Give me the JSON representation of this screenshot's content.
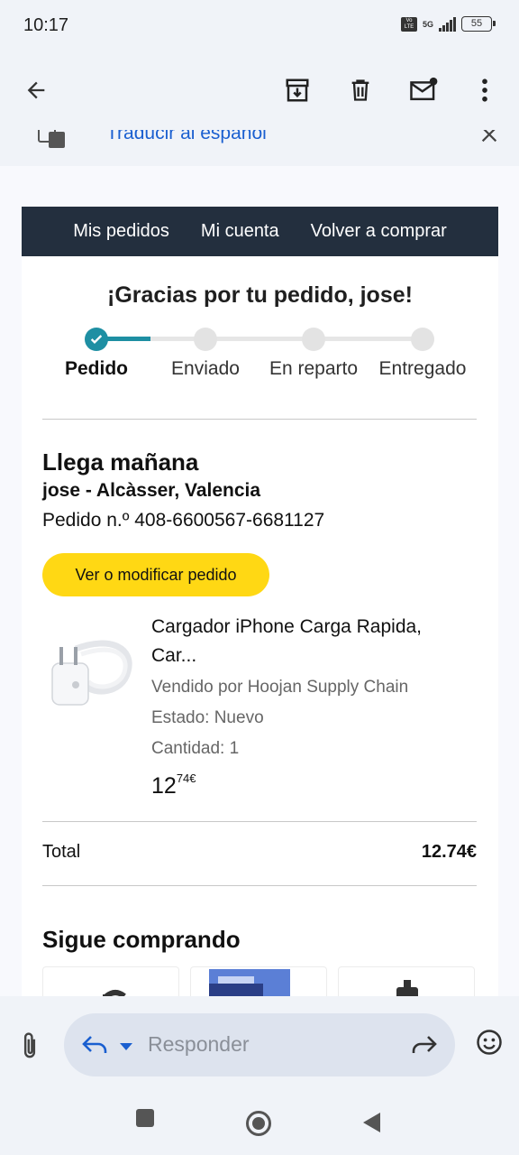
{
  "status": {
    "time": "10:17",
    "volte": "Vo LTE",
    "network": "5G",
    "battery": "55"
  },
  "toolbar": {
    "icons": [
      "back-arrow-icon",
      "archive-icon",
      "delete-icon",
      "mark-unread-icon",
      "more-vert-icon"
    ]
  },
  "translate": {
    "label": "Traducir al español"
  },
  "email": {
    "nav": [
      "Mis pedidos",
      "Mi cuenta",
      "Volver a comprar"
    ],
    "thanks": "¡Gracias por tu pedido, jose!",
    "steps": [
      "Pedido",
      "Enviado",
      "En reparto",
      "Entregado"
    ],
    "progress_step": 1,
    "arrival": "Llega mañana",
    "address": "jose - Alcàsser, Valencia",
    "order_number": "Pedido n.º 408-6600567-6681127",
    "view_button": "Ver o modificar pedido",
    "product": {
      "title": "Cargador iPhone Carga Rapida, Car...",
      "seller": "Vendido por Hoojan Supply Chain",
      "condition": "Estado: Nuevo",
      "quantity": "Cantidad: 1",
      "price_whole": "12",
      "price_fraction": "74€"
    },
    "total_label": "Total",
    "total_value": "12.74€",
    "keep_shopping": "Sigue comprando"
  },
  "reply": {
    "placeholder": "Responder"
  },
  "colors": {
    "accent_teal": "#1e8fa3",
    "amazon_nav": "#232f3e",
    "button_yellow": "#ffd814",
    "link_blue": "#1a5fd0"
  }
}
